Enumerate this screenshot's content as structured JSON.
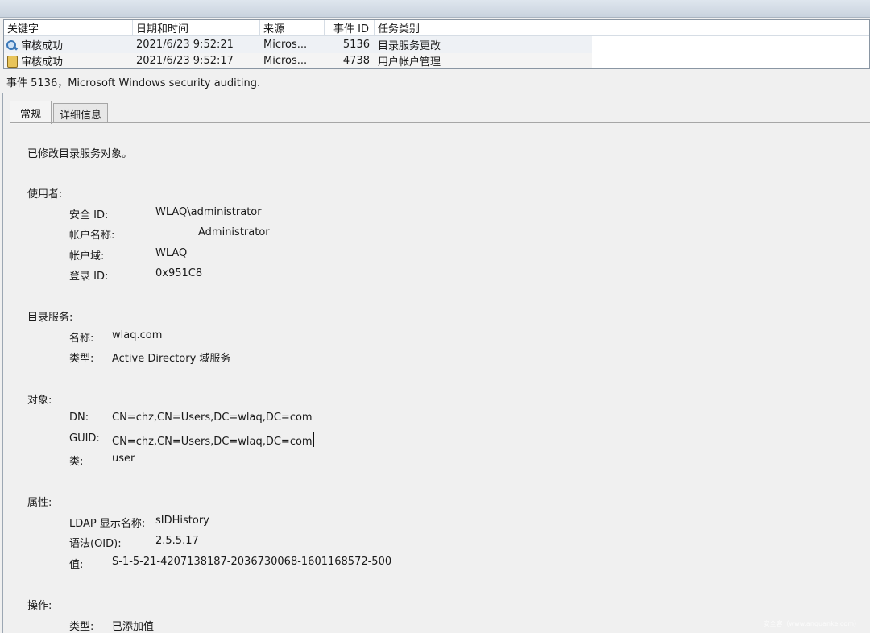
{
  "event_list": {
    "columns": [
      "关键字",
      "日期和时间",
      "来源",
      "事件 ID",
      "任务类别"
    ],
    "rows": [
      {
        "icon": "audit-success-icon",
        "keyword": "审核成功",
        "datetime": "2021/6/23 9:52:21",
        "source": "Micros...",
        "event_id": "5136",
        "category": "目录服务更改"
      },
      {
        "icon": "audit-success-icon",
        "keyword": "审核成功",
        "datetime": "2021/6/23 9:52:17",
        "source": "Micros...",
        "event_id": "4738",
        "category": "用户帐户管理"
      }
    ]
  },
  "detail": {
    "title": "事件 5136，Microsoft Windows security auditing.",
    "tabs": [
      "常规",
      "详细信息"
    ],
    "summary": "已修改目录服务对象。",
    "subject": {
      "heading": "使用者:",
      "fields": [
        {
          "label": "安全 ID:",
          "value": "WLAQ\\administrator"
        },
        {
          "label": "帐户名称:",
          "value": "Administrator"
        },
        {
          "label": "帐户域:",
          "value": "WLAQ"
        },
        {
          "label": "登录 ID:",
          "value": "0x951C8"
        }
      ]
    },
    "directory_service": {
      "heading": "目录服务:",
      "fields": [
        {
          "label": "名称:",
          "value": "wlaq.com"
        },
        {
          "label": "类型:",
          "value": "Active Directory 域服务"
        }
      ]
    },
    "object": {
      "heading": "对象:",
      "fields": [
        {
          "label": "DN:",
          "value": "CN=chz,CN=Users,DC=wlaq,DC=com"
        },
        {
          "label": "GUID:",
          "value": "CN=chz,CN=Users,DC=wlaq,DC=com"
        },
        {
          "label": "类:",
          "value": "user"
        }
      ]
    },
    "attribute": {
      "heading": "属性:",
      "fields": [
        {
          "label": "LDAP 显示名称:",
          "value": "sIDHistory"
        },
        {
          "label": "语法(OID):",
          "value": "2.5.5.17"
        },
        {
          "label": "值:",
          "value": "S-1-5-21-4207138187-2036730068-1601168572-500"
        }
      ]
    },
    "operation": {
      "heading": "操作:",
      "fields": [
        {
          "label": "类型:",
          "value": "已添加值"
        }
      ]
    }
  },
  "watermark": "安全客（www.anquanke.com）"
}
